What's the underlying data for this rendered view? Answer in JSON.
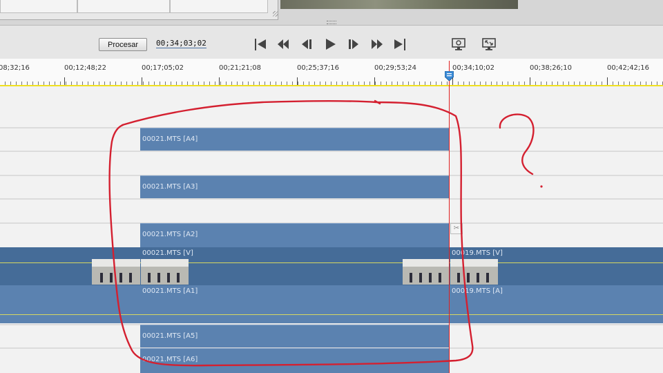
{
  "toolbar": {
    "render_label": "Procesar",
    "timecode": "00;34;03;02",
    "transport_buttons": [
      "go-to-start",
      "previous-frame-step",
      "step-back",
      "play",
      "step-forward",
      "next-frame-step",
      "go-to-end"
    ],
    "extra_buttons": [
      "export-frame",
      "fit-window"
    ]
  },
  "ruler": {
    "labels": [
      "08;32;16",
      "00;12;48;22",
      "00;17;05;02",
      "00;21;21;08",
      "00;25;37;16",
      "00;29;53;24",
      "00;34;10;02",
      "00;38;26;10",
      "00;42;42;16"
    ],
    "playhead_color": "#e02020",
    "accent_yellow": "#f0e020"
  },
  "tracks": {
    "clip_a4": "00021.MTS [A4]",
    "clip_a3": "00021.MTS [A3]",
    "clip_a2": "00021.MTS [A2]",
    "clip_v1": "00021.MTS [V]",
    "clip_a1": "00021.MTS [A1]",
    "clip_a5": "00021.MTS [A5]",
    "clip_a6": "00021.MTS [A6]",
    "clip_v2": "00019.MTS [V]",
    "clip_a1b": "00019.MTS [A]",
    "clip_color": "#5b82b0",
    "video_track_color": "#456c98"
  },
  "annotation": {
    "color": "#d42030",
    "shape": "hand-drawn-circle-with-question-mark"
  }
}
